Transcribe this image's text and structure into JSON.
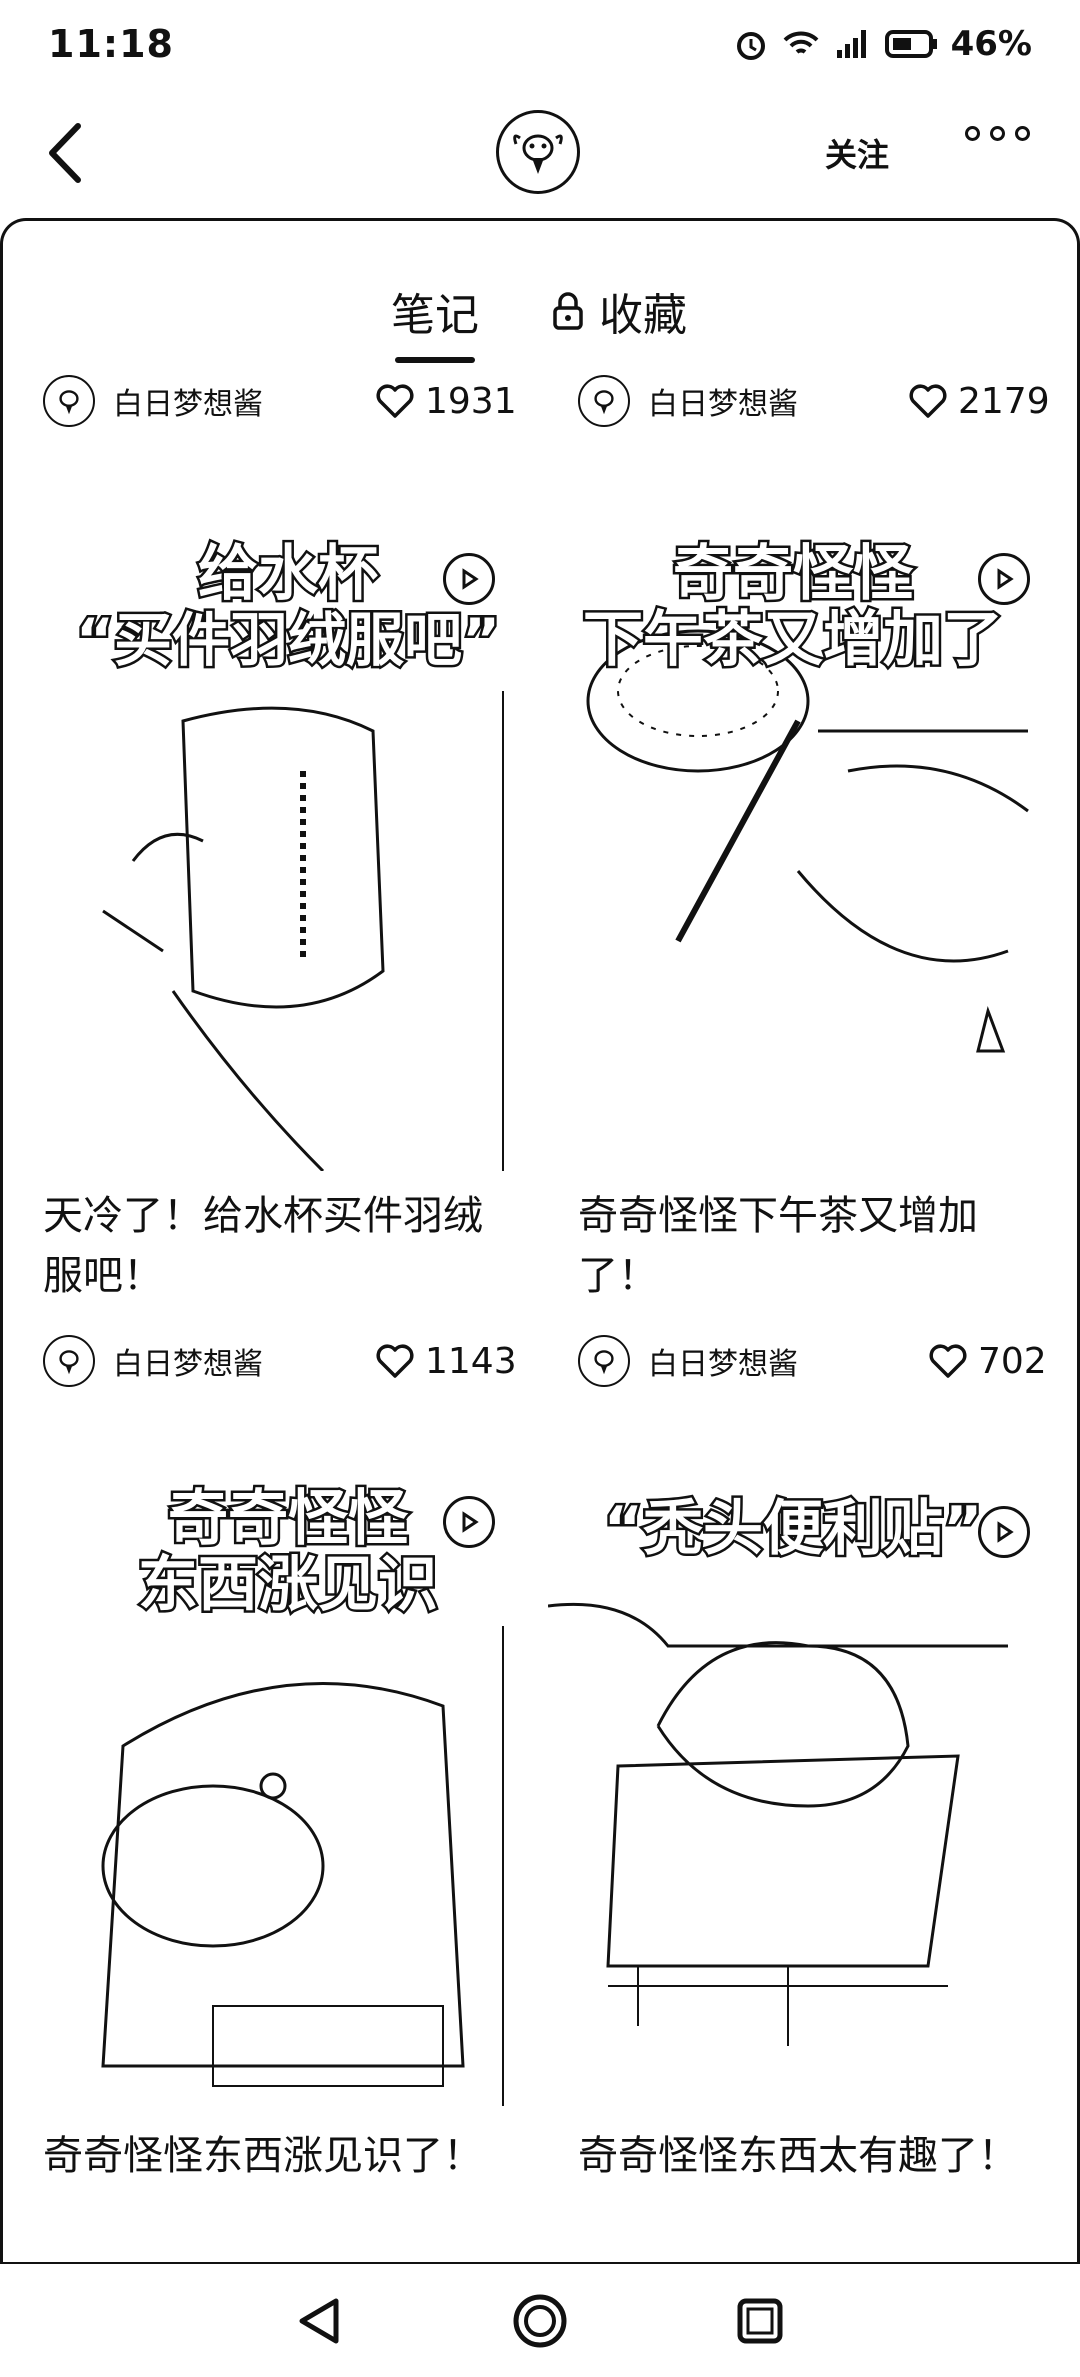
{
  "status": {
    "time": "11:18",
    "battery": "46%"
  },
  "header": {
    "follow_label": "关注"
  },
  "tabs": {
    "notes": "笔记",
    "favorites": "收藏"
  },
  "posts": [
    {
      "author": "白日梦想酱",
      "likes": "1931",
      "overlay_line1": "给水杯",
      "overlay_line2": "“买件羽绒服吧”",
      "title": "天冷了！给水杯买件羽绒服吧！"
    },
    {
      "author": "白日梦想酱",
      "likes": "2179",
      "overlay_line1": "奇奇怪怪",
      "overlay_line2": "下午茶又增加了",
      "title": "奇奇怪怪下午茶又增加了！"
    },
    {
      "author": "白日梦想酱",
      "likes": "1143",
      "overlay_line1": "奇奇怪怪",
      "overlay_line2": "东西涨见识",
      "title": "奇奇怪怪东西涨见识了！"
    },
    {
      "author": "白日梦想酱",
      "likes": "702",
      "overlay_line1": "",
      "overlay_line2": "“秃头便利贴”",
      "title": "奇奇怪怪东西太有趣了！"
    }
  ]
}
